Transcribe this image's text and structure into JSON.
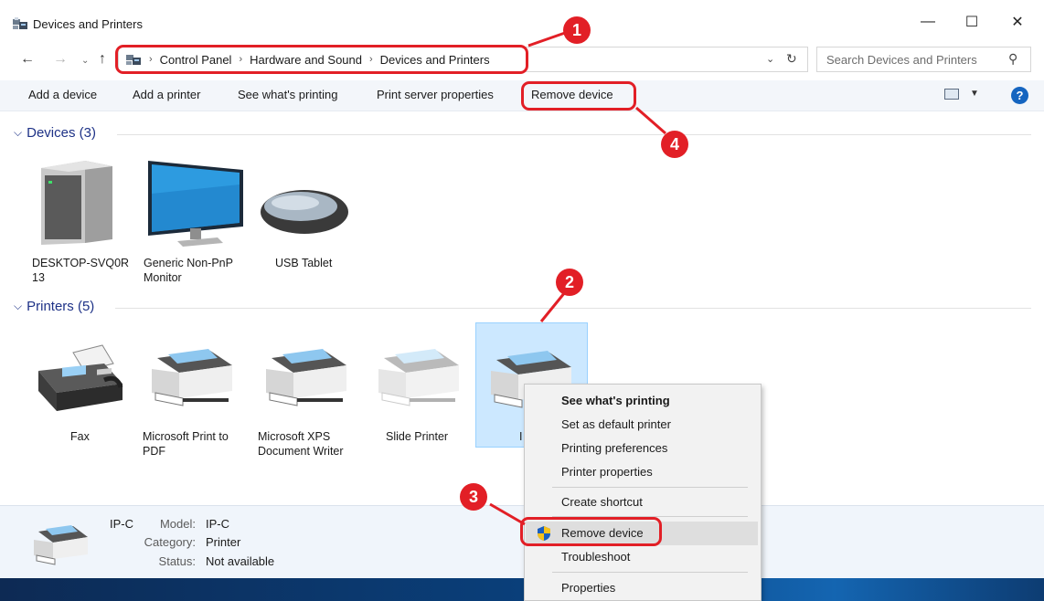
{
  "window": {
    "title": "Devices and Printers",
    "minimize": "—",
    "maximize": "☐",
    "close": "✕"
  },
  "address": {
    "crumbs": [
      "Control Panel",
      "Hardware and Sound",
      "Devices and Printers"
    ],
    "search_placeholder": "Search Devices and Printers"
  },
  "toolbar": {
    "add_device": "Add a device",
    "add_printer": "Add a printer",
    "see_printing": "See what's printing",
    "print_server": "Print server properties",
    "remove_device": "Remove device"
  },
  "groups": {
    "devices": {
      "label": "Devices (3)",
      "items": [
        "DESKTOP-SVQ0R\n13",
        "Generic Non-PnP\nMonitor",
        "USB Tablet"
      ]
    },
    "printers": {
      "label": "Printers (5)",
      "items": [
        "Fax",
        "Microsoft Print to\nPDF",
        "Microsoft XPS\nDocument Writer",
        "Slide Printer",
        "I"
      ]
    }
  },
  "details": {
    "name": "IP-C",
    "model_key": "Model:",
    "model_val": "IP-C",
    "category_key": "Category:",
    "category_val": "Printer",
    "status_key": "Status:",
    "status_val": "Not available"
  },
  "context_menu": {
    "items": [
      "See what's printing",
      "Set as default printer",
      "Printing preferences",
      "Printer properties",
      "Create shortcut",
      "Remove device",
      "Troubleshoot",
      "Properties"
    ]
  },
  "callouts": [
    "1",
    "2",
    "3",
    "4"
  ],
  "colors": {
    "accent": "#1e3287",
    "callout": "#e21f26",
    "selection": "#cce8ff"
  }
}
